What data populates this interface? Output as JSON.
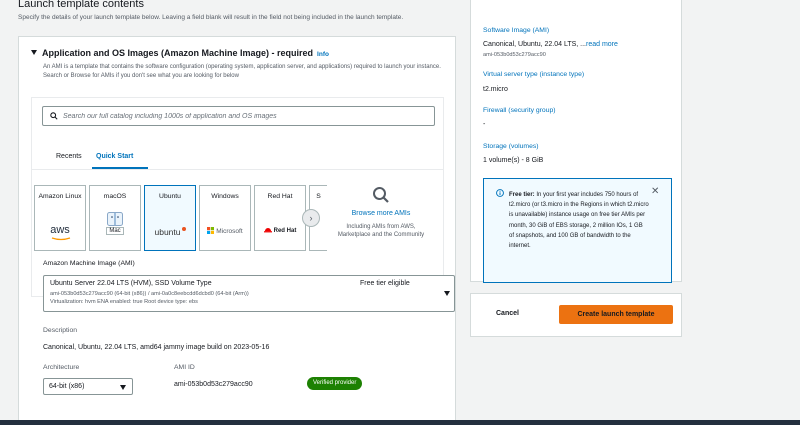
{
  "page": {
    "title": "Launch template contents",
    "subtitle": "Specify the details of your launch template below. Leaving a field blank will result in the field not being included in the launch template."
  },
  "ami_section": {
    "heading": "Application and OS Images (Amazon Machine Image) - required",
    "info_link": "Info",
    "description": "An AMI is a template that contains the software configuration (operating system, application server, and applications) required to launch your instance. Search or Browse for AMIs if you don't see what you are looking for below",
    "search": {
      "placeholder": "Search our full catalog including 1000s of application and OS images"
    },
    "tabs": [
      {
        "label": "Recents",
        "active": false
      },
      {
        "label": "Quick Start",
        "active": true
      }
    ],
    "os_cards": [
      {
        "name": "Amazon Linux",
        "logo": "aws",
        "icon": "aws-logo-icon",
        "selected": false
      },
      {
        "name": "macOS",
        "logo": "Mac",
        "icon": "mac-finder-icon",
        "selected": false
      },
      {
        "name": "Ubuntu",
        "logo": "ubuntu",
        "icon": "ubuntu-logo-icon",
        "selected": true
      },
      {
        "name": "Windows",
        "logo": "Microsoft",
        "icon": "microsoft-logo-icon",
        "selected": false
      },
      {
        "name": "Red Hat",
        "logo": "Red Hat",
        "icon": "redhat-logo-icon",
        "selected": false
      },
      {
        "name": "S",
        "logo": "",
        "icon": "",
        "selected": false
      }
    ],
    "browse_more": {
      "link": "Browse more AMIs",
      "description": "Including AMIs from AWS, Marketplace and the Community"
    },
    "ami_select": {
      "label": "Amazon Machine Image (AMI)",
      "name": "Ubuntu Server 22.04 LTS (HVM), SSD Volume Type",
      "badge": "Free tier eligible",
      "detail_line1": "ami-053b0d53c279acc90 (64-bit (x86)) / ami-0a0c8eebcdd6dcbd0 (64-bit (Arm))",
      "detail_line2": "Virtualization: hvm    ENA enabled: true    Root device type: ebs"
    },
    "description_field": {
      "label": "Description",
      "value": "Canonical, Ubuntu, 22.04 LTS, amd64 jammy image build on 2023-05-16"
    },
    "architecture": {
      "label": "Architecture",
      "value": "64-bit (x86)"
    },
    "ami_id": {
      "label": "AMI ID",
      "value": "ami-053b0d53c279acc90",
      "badge": "Verified provider"
    }
  },
  "summary": {
    "software_image": {
      "label": "Software Image (AMI)",
      "value": "Canonical, Ubuntu, 22.04 LTS, ...",
      "read_more": "read more",
      "id": "ami-053b0d53c279acc90"
    },
    "instance_type": {
      "label": "Virtual server type (instance type)",
      "value": "t2.micro"
    },
    "firewall": {
      "label": "Firewall (security group)",
      "value": "-"
    },
    "storage": {
      "label": "Storage (volumes)",
      "value": "1 volume(s) - 8 GiB"
    },
    "free_tier": {
      "title": "Free tier:",
      "text": "In your first year includes 750 hours of t2.micro (or t3.micro in the Regions in which t2.micro is unavailable) instance usage on free tier AMIs per month, 30 GiB of EBS storage, 2 million IOs, 1 GB of snapshots, and 100 GB of bandwidth to the internet."
    }
  },
  "actions": {
    "cancel": "Cancel",
    "create": "Create launch template"
  },
  "colors": {
    "link": "#0073bb",
    "primary_button": "#ec7211",
    "verified": "#1d8102",
    "info_bg": "#f1faff"
  }
}
